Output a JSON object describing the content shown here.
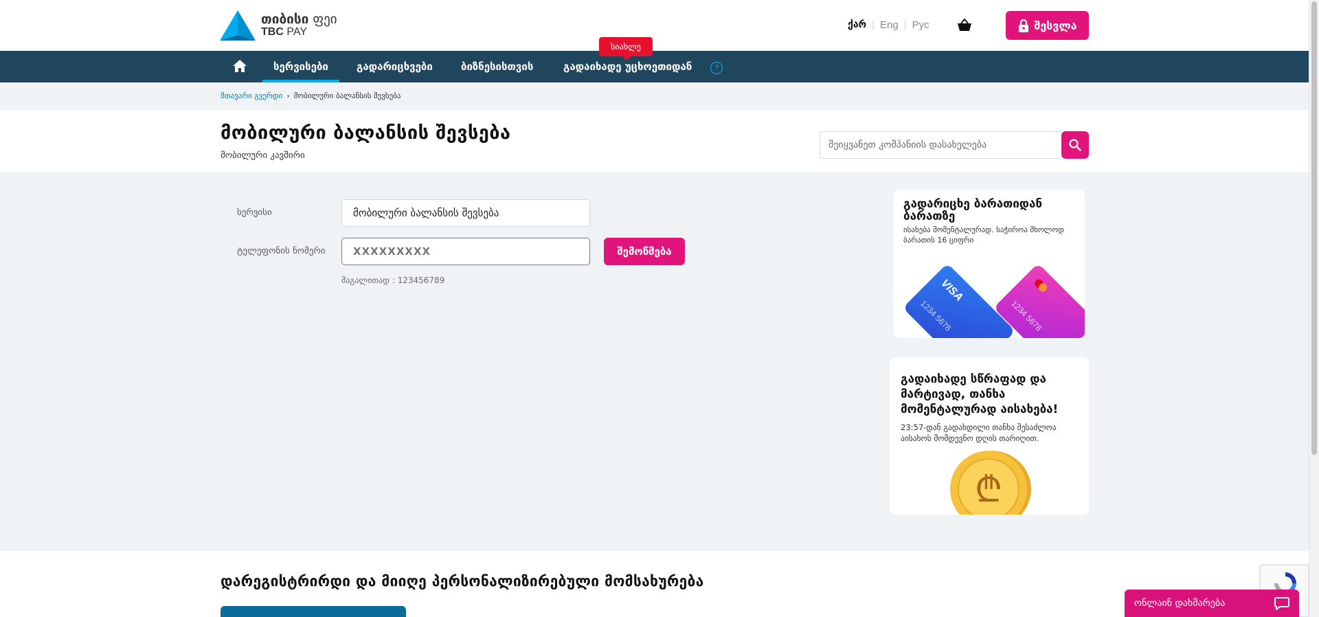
{
  "header": {
    "logo_ka_bold": "თიბისი",
    "logo_ka_light": "ფეი",
    "logo_en_bold": "TBC",
    "logo_en_light": "PAY",
    "langs": [
      "ქარ",
      "Eng",
      "Рус"
    ],
    "active_lang": "ქარ",
    "login_label": "შესვლა",
    "brand_color": "#e0147b"
  },
  "nav": {
    "items": [
      {
        "label": "სერვისები",
        "active": true
      },
      {
        "label": "გადარიცხვები",
        "active": false
      },
      {
        "label": "ბიზნესისთვის",
        "active": false
      },
      {
        "label": "გადაიხადე უცხოეთიდან",
        "active": false
      }
    ],
    "new_badge": "სიახლე",
    "help": "?",
    "background": "#20465e"
  },
  "breadcrumb": {
    "home": "მთავარი გვერდი",
    "current": "მობილური ბალანსის შევსება"
  },
  "page": {
    "title": "მობილური ბალანსის შევსება",
    "subtitle": "მობილური კავშირი",
    "search_placeholder": "შეიყვანეთ კომპანიის დასახელება"
  },
  "form": {
    "service_label": "სერვისი",
    "service_value": "მობილური ბალანსის შევსება",
    "phone_label": "ტელეფონის ნომერი",
    "phone_placeholder": "XXXXXXXXX",
    "check_button": "შემოწმება",
    "hint": "მაგალითად : 123456789"
  },
  "promos": [
    {
      "title": "გადარიცხე ბარათიდან ბარათზე",
      "text": "ისახება მომენტალურად. საჭიროა მხოლოდ ბარათის 16 ციფრი",
      "card_visa": "VISA",
      "card_number": "1234 5678"
    },
    {
      "title": "გადაიხადე სწრაფად და მარტივად, თანხა მომენტალურად აისახება!",
      "text": "23:57-დან გადახდილი თანხა შესაძლოა აისახოს მომდევნო დღის თარიღით.",
      "coin_symbol": "₾"
    }
  ],
  "register": {
    "title": "დარეგისტრირდი და მიიღე პერსონალიზირებული მომსახურება"
  },
  "chat": {
    "label": "ონლაინ დახმარება"
  }
}
